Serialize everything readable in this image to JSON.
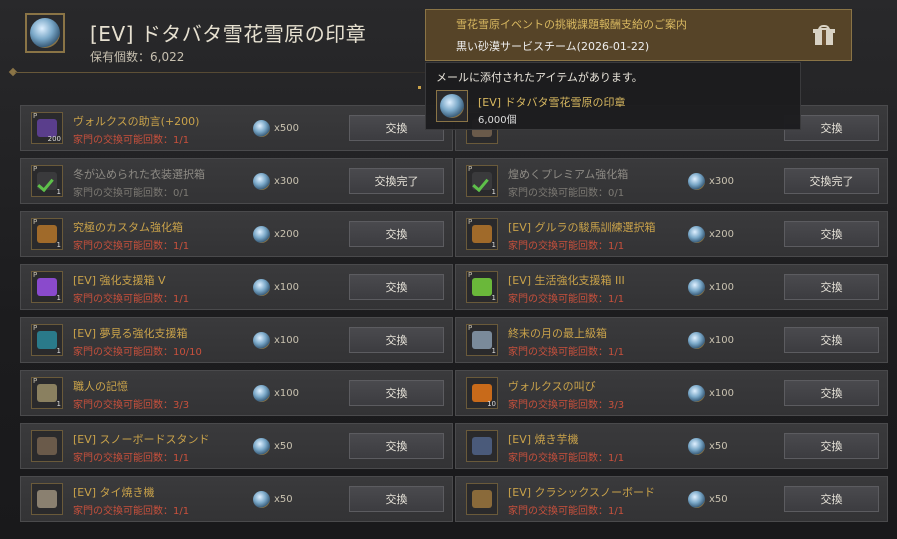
{
  "header": {
    "title": "[EV] ドタバタ雪花雪原の印章",
    "owned_label": "保有個数：6,022",
    "icon": "snow-seal-coin-icon"
  },
  "notification": {
    "title": "雪花雪原イベントの挑戦課題報酬支給のご案内",
    "sender": "黒い砂漠サービスチーム(2026-01-22)",
    "icon": "gift-icon"
  },
  "tooltip": {
    "label": "メールに添付されたアイテムがあります。",
    "item_name": "[EV] ドタバタ雪花雪原の印章",
    "item_qty": "6,000個"
  },
  "rows": [
    [
      {
        "icon": "seal-bundle-icon",
        "grade": "P",
        "count": "200",
        "color": "#5a3e8c",
        "name": "ヴォルクスの助言(+200)",
        "limit": "家門の交換可能回数：1/1",
        "price": "x500",
        "button": "交換",
        "done": false
      },
      {
        "icon": "chest-icon",
        "grade": "",
        "count": "",
        "color": "#6a5a4a",
        "name": "",
        "limit": "",
        "price": "",
        "button": "交換",
        "done": false
      }
    ],
    [
      {
        "icon": "costume-box-icon",
        "grade": "P",
        "count": "1",
        "color": "#3a3a3c",
        "name": "冬が込められた衣装選択箱",
        "limit": "家門の交換可能回数：0/1",
        "price": "x300",
        "button": "交換完了",
        "done": true
      },
      {
        "icon": "premium-box-icon",
        "grade": "P",
        "count": "1",
        "color": "#3a3a3c",
        "name": "煌めくプレミアム強化箱",
        "limit": "家門の交換可能回数：0/1",
        "price": "x300",
        "button": "交換完了",
        "done": true
      }
    ],
    [
      {
        "icon": "treasure-chest-icon",
        "grade": "P",
        "count": "1",
        "color": "#a06a2a",
        "name": "究極のカスタム強化箱",
        "limit": "家門の交換可能回数：1/1",
        "price": "x200",
        "button": "交換",
        "done": false
      },
      {
        "icon": "treasure-chest-icon",
        "grade": "P",
        "count": "1",
        "color": "#a06a2a",
        "name": "[EV] グルラの駿馬訓練選択箱",
        "limit": "家門の交換可能回数：1/1",
        "price": "x200",
        "button": "交換",
        "done": false
      }
    ],
    [
      {
        "icon": "purple-box-icon",
        "grade": "P",
        "count": "1",
        "color": "#8a4acc",
        "name": "[EV] 強化支援箱 V",
        "limit": "家門の交換可能回数：1/1",
        "price": "x100",
        "button": "交換",
        "done": false
      },
      {
        "icon": "green-box-icon",
        "grade": "P",
        "count": "1",
        "color": "#6ab83a",
        "name": "[EV] 生活強化支援箱 III",
        "limit": "家門の交換可能回数：1/1",
        "price": "x100",
        "button": "交換",
        "done": false
      }
    ],
    [
      {
        "icon": "teal-chest-icon",
        "grade": "P",
        "count": "1",
        "color": "#2a7a8a",
        "name": "[EV] 夢見る強化支援箱",
        "limit": "家門の交換可能回数：10/10",
        "price": "x100",
        "button": "交換",
        "done": false
      },
      {
        "icon": "silver-box-icon",
        "grade": "P",
        "count": "1",
        "color": "#7a8a9a",
        "name": "終末の月の最上級箱",
        "limit": "家門の交換可能回数：1/1",
        "price": "x100",
        "button": "交換",
        "done": false
      }
    ],
    [
      {
        "icon": "memory-scroll-icon",
        "grade": "P",
        "count": "1",
        "color": "#8a8060",
        "name": "職人の記憶",
        "limit": "家門の交換可能回数：3/3",
        "price": "x100",
        "button": "交換",
        "done": false
      },
      {
        "icon": "orange-orb-icon",
        "grade": "",
        "count": "10",
        "color": "#c86a1a",
        "name": "ヴォルクスの叫び",
        "limit": "家門の交換可能回数：3/3",
        "price": "x100",
        "button": "交換",
        "done": false
      }
    ],
    [
      {
        "icon": "snowboard-stand-icon",
        "grade": "",
        "count": "",
        "color": "#6a5a4a",
        "name": "[EV] スノーボードスタンド",
        "limit": "家門の交換可能回数：1/1",
        "price": "x50",
        "button": "交換",
        "done": false
      },
      {
        "icon": "roasting-machine-icon",
        "grade": "",
        "count": "",
        "color": "#4a5a7a",
        "name": "[EV] 焼き芋機",
        "limit": "家門の交換可能回数：1/1",
        "price": "x50",
        "button": "交換",
        "done": false
      }
    ],
    [
      {
        "icon": "taiyaki-machine-icon",
        "grade": "",
        "count": "",
        "color": "#8a8070",
        "name": "[EV] タイ焼き機",
        "limit": "家門の交換可能回数：1/1",
        "price": "x50",
        "button": "交換",
        "done": false
      },
      {
        "icon": "snowboard-icon",
        "grade": "",
        "count": "",
        "color": "#8a6a3a",
        "name": "[EV] クラシックスノーボード",
        "limit": "家門の交換可能回数：1/1",
        "price": "x50",
        "button": "交換",
        "done": false
      }
    ]
  ]
}
